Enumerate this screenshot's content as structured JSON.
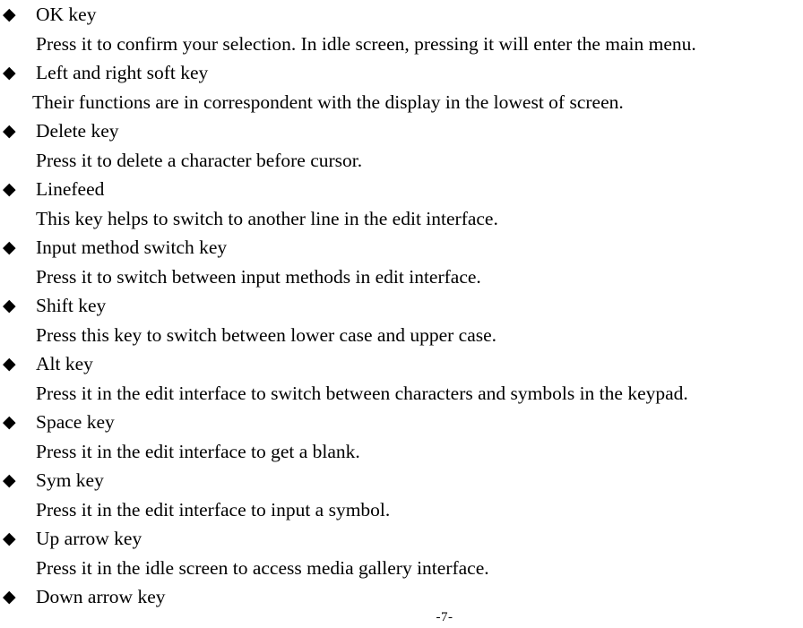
{
  "document": {
    "page_number_label": "-7-",
    "bullet_glyph": "◆",
    "bullet_icon_name": "diamond-bullet-icon",
    "text_color": "#000000",
    "background_color": "#ffffff"
  },
  "entries": [
    {
      "heading": "OK key",
      "description": "Press it to confirm your selection. In idle screen, pressing it will enter the main menu."
    },
    {
      "heading": "Left and right soft key",
      "description": "Their functions are in correspondent with the display in the lowest of screen."
    },
    {
      "heading": "Delete key",
      "description": "Press it to delete a character before cursor."
    },
    {
      "heading": "Linefeed",
      "description": "This key helps to switch to another line in the edit interface."
    },
    {
      "heading": "Input method switch key",
      "description": "Press it to switch between input methods in edit interface."
    },
    {
      "heading": "Shift key",
      "description": "Press this key to switch between lower case and upper case."
    },
    {
      "heading": "Alt key",
      "description": "Press it in the edit interface to switch between characters and symbols in the keypad."
    },
    {
      "heading": "Space key",
      "description": "Press it in the edit interface to get a blank."
    },
    {
      "heading": "Sym key",
      "description": "Press it in the edit interface to input a symbol."
    },
    {
      "heading": "Up arrow key",
      "description": "Press it in the idle screen to access media gallery interface."
    },
    {
      "heading": "Down arrow key",
      "description": null
    }
  ]
}
